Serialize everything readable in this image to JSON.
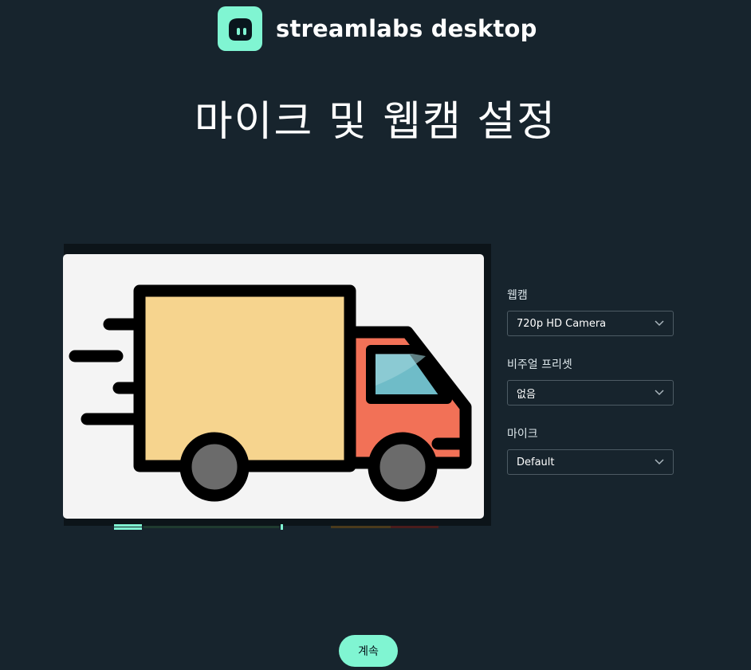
{
  "brand": {
    "name": "streamlabs desktop",
    "accent": "#80f5d2"
  },
  "page": {
    "title": "마이크 및 웹캠 설정"
  },
  "settings": {
    "webcam": {
      "label": "웹캠",
      "value": "720p HD Camera"
    },
    "visual_preset": {
      "label": "비주얼 프리셋",
      "value": "없음"
    },
    "microphone": {
      "label": "마이크",
      "value": "Default"
    }
  },
  "actions": {
    "continue_label": "계속"
  },
  "icons": {
    "logo": "streamlabs-logo-icon",
    "preview": "delivery-truck-icon",
    "select": "chevron-down-icon"
  }
}
